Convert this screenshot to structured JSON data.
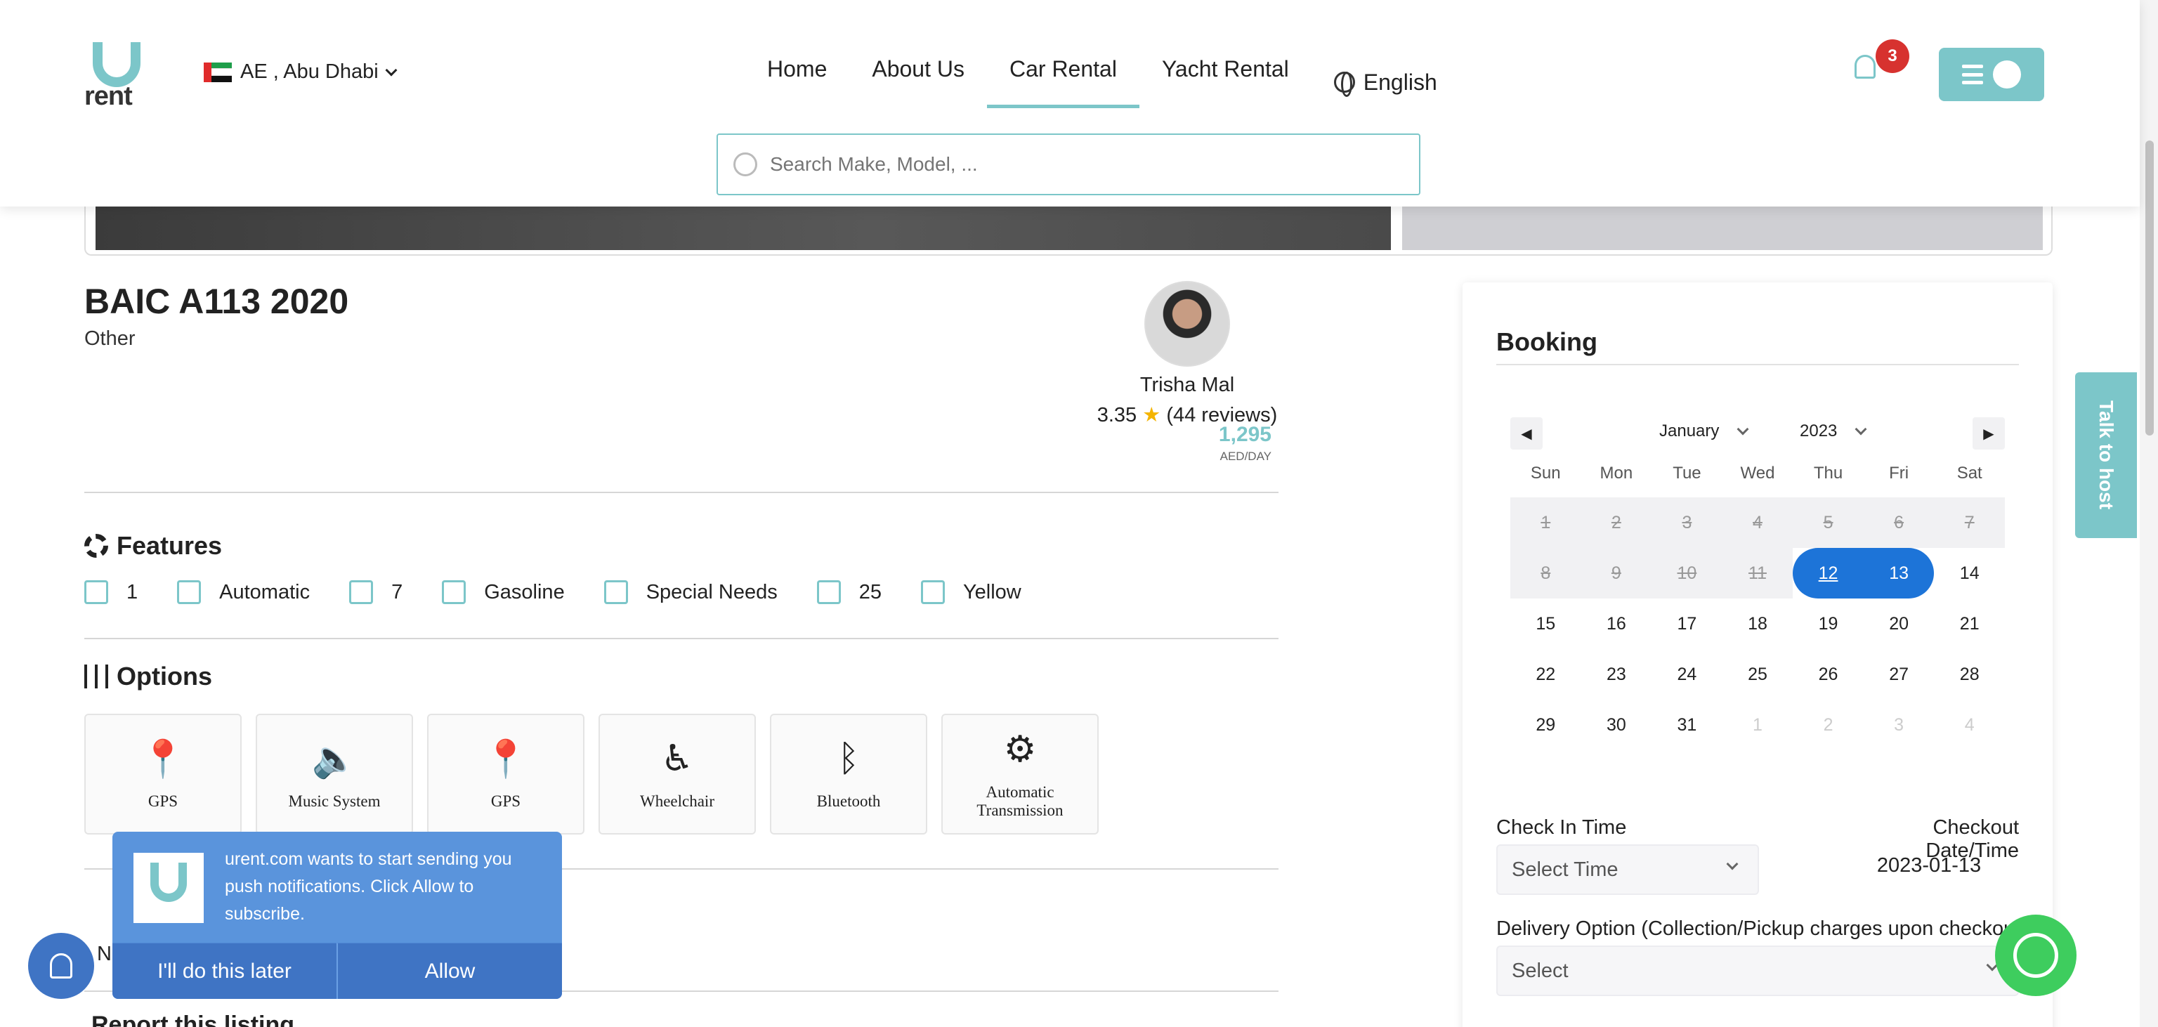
{
  "header": {
    "logo_text": "rent",
    "location": "AE , Abu Dhabi",
    "nav": [
      {
        "label": "Home"
      },
      {
        "label": "About Us"
      },
      {
        "label": "Car Rental",
        "active": true
      },
      {
        "label": "Yacht Rental"
      }
    ],
    "language": "English",
    "notification_count": "3",
    "search_placeholder": "Search Make, Model, ..."
  },
  "car": {
    "title": "BAIC A113 2020",
    "category": "Other"
  },
  "host": {
    "name": "Trisha Mal",
    "rating": "3.35",
    "reviews": "(44 reviews)",
    "price": "1,295",
    "price_unit": "AED/DAY"
  },
  "features": {
    "title": "Features",
    "items": [
      {
        "icon": "door-icon",
        "value": "1"
      },
      {
        "icon": "gearbox-icon",
        "value": "Automatic"
      },
      {
        "icon": "seat-icon",
        "value": "7"
      },
      {
        "icon": "fuel-icon",
        "value": "Gasoline"
      },
      {
        "icon": "car-icon",
        "value": "Special Needs"
      },
      {
        "icon": "seat-icon",
        "value": "25"
      },
      {
        "icon": "paint-icon",
        "value": "Yellow"
      }
    ]
  },
  "options": {
    "title": "Options",
    "items": [
      {
        "icon": "gps-icon",
        "glyph": "📍",
        "label": "GPS"
      },
      {
        "icon": "speaker-icon",
        "glyph": "🔈",
        "label": "Music System"
      },
      {
        "icon": "gps-icon",
        "glyph": "📍",
        "label": "GPS"
      },
      {
        "icon": "wheelchair-icon",
        "glyph": "♿",
        "label": "Wheelchair"
      },
      {
        "icon": "bluetooth-icon",
        "glyph": "ᛒ",
        "label": "Bluetooth"
      },
      {
        "icon": "transmission-icon",
        "glyph": "⚙",
        "label": "Automatic Transmission"
      }
    ]
  },
  "booking": {
    "title": "Booking",
    "month": "January",
    "year": "2023",
    "weekdays": [
      "Sun",
      "Mon",
      "Tue",
      "Wed",
      "Thu",
      "Fri",
      "Sat"
    ],
    "days": [
      {
        "d": "1",
        "s": "past"
      },
      {
        "d": "2",
        "s": "past"
      },
      {
        "d": "3",
        "s": "past"
      },
      {
        "d": "4",
        "s": "past"
      },
      {
        "d": "5",
        "s": "past"
      },
      {
        "d": "6",
        "s": "past"
      },
      {
        "d": "7",
        "s": "past"
      },
      {
        "d": "8",
        "s": "past"
      },
      {
        "d": "9",
        "s": "past"
      },
      {
        "d": "10",
        "s": "past"
      },
      {
        "d": "11",
        "s": "past"
      },
      {
        "d": "12",
        "s": "sel start"
      },
      {
        "d": "13",
        "s": "sel end"
      },
      {
        "d": "14",
        "s": ""
      },
      {
        "d": "15",
        "s": ""
      },
      {
        "d": "16",
        "s": ""
      },
      {
        "d": "17",
        "s": ""
      },
      {
        "d": "18",
        "s": ""
      },
      {
        "d": "19",
        "s": ""
      },
      {
        "d": "20",
        "s": ""
      },
      {
        "d": "21",
        "s": ""
      },
      {
        "d": "22",
        "s": ""
      },
      {
        "d": "23",
        "s": ""
      },
      {
        "d": "24",
        "s": ""
      },
      {
        "d": "25",
        "s": ""
      },
      {
        "d": "26",
        "s": ""
      },
      {
        "d": "27",
        "s": ""
      },
      {
        "d": "28",
        "s": ""
      },
      {
        "d": "29",
        "s": ""
      },
      {
        "d": "30",
        "s": ""
      },
      {
        "d": "31",
        "s": ""
      },
      {
        "d": "1",
        "s": "other"
      },
      {
        "d": "2",
        "s": "other"
      },
      {
        "d": "3",
        "s": "other"
      },
      {
        "d": "4",
        "s": "other"
      }
    ],
    "check_in_label": "Check In Time",
    "check_in_placeholder": "Select Time",
    "checkout_label": "Checkout Date/Time",
    "checkout_value": "2023-01-13",
    "delivery_label": "Delivery Option (Collection/Pickup charges upon checkout",
    "delivery_placeholder": "Select"
  },
  "talk_to_host": "Talk to host",
  "push": {
    "message": "urent.com wants to start sending you push notifications. Click Allow to subscribe.",
    "later": "I'll do this later",
    "allow": "Allow"
  },
  "partial_text": "Nc",
  "report_text": "Report this listing",
  "colors": {
    "accent": "#7cc6c9",
    "selected": "#1d74d8",
    "badge": "#d7322f",
    "push": "#5a94dc",
    "whatsapp": "#3ecd5e"
  }
}
